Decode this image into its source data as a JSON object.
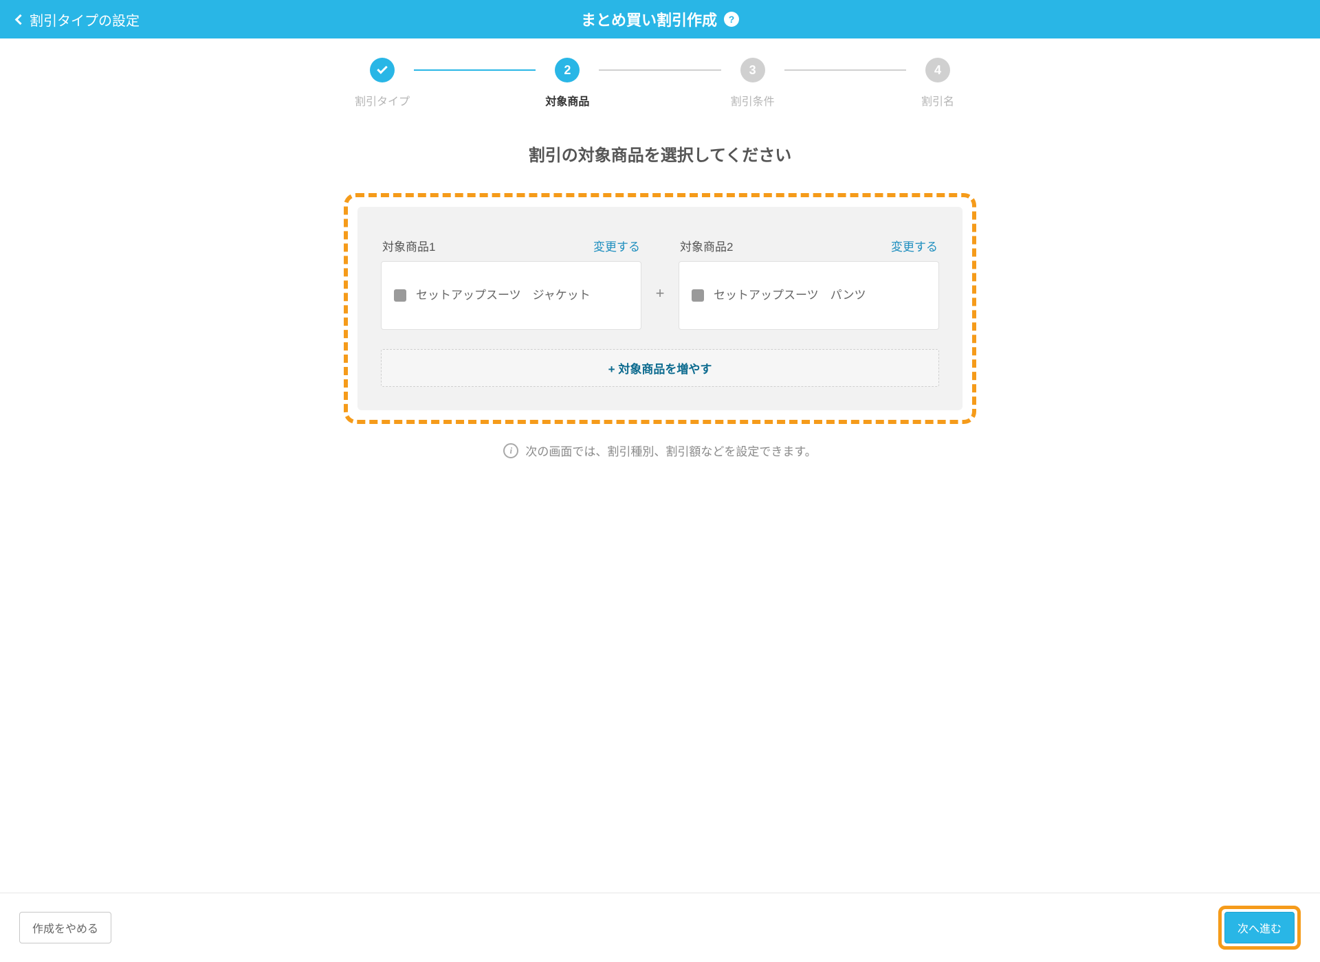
{
  "header": {
    "back_label": "割引タイプの設定",
    "title": "まとめ買い割引作成",
    "help_icon": "?"
  },
  "stepper": {
    "steps": [
      {
        "status": "done",
        "label": "割引タイプ",
        "marker": "check"
      },
      {
        "status": "active",
        "label": "対象商品",
        "marker": "2"
      },
      {
        "status": "upcoming",
        "label": "割引条件",
        "marker": "3"
      },
      {
        "status": "upcoming",
        "label": "割引名",
        "marker": "4"
      }
    ]
  },
  "main": {
    "heading": "割引の対象商品を選択してください",
    "change_label": "変更する",
    "plus_label": "+",
    "add_more_label": "+ 対象商品を増やす",
    "info_text": "次の画面では、割引種別、割引額などを設定できます。",
    "products": [
      {
        "slot_label": "対象商品1",
        "name": "セットアップスーツ　ジャケット"
      },
      {
        "slot_label": "対象商品2",
        "name": "セットアップスーツ　パンツ"
      }
    ]
  },
  "footer": {
    "cancel_label": "作成をやめる",
    "next_label": "次へ進む"
  },
  "colors": {
    "accent": "#29b6e6",
    "highlight": "#f59b1a"
  }
}
